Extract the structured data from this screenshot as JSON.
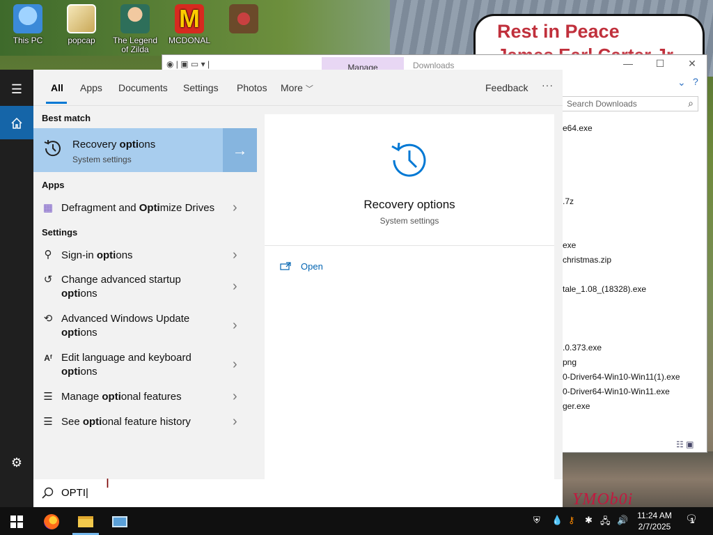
{
  "desktop": {
    "icons": [
      {
        "label": "This PC",
        "icon": "computer-icon",
        "color": "#3b8ad8"
      },
      {
        "label": "popcap",
        "icon": "folder-app-icon",
        "color": "#d0b56a"
      },
      {
        "label": "The Legend of Zilda",
        "icon": "game-character-icon",
        "color": "#3a8a6a"
      },
      {
        "label": "MCDONAL",
        "icon": "mcdonalds-icon",
        "color": "#d62a1f"
      },
      {
        "label": "...",
        "icon": "christmas-icon",
        "color": "#8a5a3a"
      }
    ],
    "sign_line1": "Rest in Peace",
    "sign_line2": "James Earl Carter Jr",
    "graffiti": "YMOb0i"
  },
  "explorer": {
    "manage_label": "Manage",
    "title": "Downloads",
    "search_placeholder": "Search Downloads",
    "files": [
      "e64.exe",
      ".7z",
      "exe",
      "christmas.zip",
      "tale_1.08_(18328).exe",
      ".0.373.exe",
      "png",
      "0-Driver64-Win10-Win11(1).exe",
      "0-Driver64-Win10-Win11.exe",
      "ger.exe"
    ]
  },
  "start_menu": {
    "tabs": [
      {
        "label": "All",
        "active": true
      },
      {
        "label": "Apps",
        "active": false
      },
      {
        "label": "Documents",
        "active": false
      },
      {
        "label": "Settings",
        "active": false
      },
      {
        "label": "Photos",
        "active": false
      },
      {
        "label": "More",
        "active": false
      }
    ],
    "feedback_label": "Feedback",
    "more_options": "···",
    "best_match_heading": "Best match",
    "best_match": {
      "title_before": "Recovery ",
      "title_bold": "opti",
      "title_after": "ons",
      "subtitle": "System settings"
    },
    "apps_heading": "Apps",
    "apps": [
      {
        "before": "Defragment and ",
        "bold": "Opti",
        "after": "mize Drives",
        "icon": "defrag-icon"
      }
    ],
    "settings_heading": "Settings",
    "settings": [
      {
        "before": "Sign-in ",
        "bold": "opti",
        "after": "ons",
        "line2": "",
        "icon": "key-icon"
      },
      {
        "before": "Change advanced startup",
        "bold": "",
        "after": "",
        "line2_bold": "opti",
        "line2_after": "ons",
        "icon": "history-icon"
      },
      {
        "before": "Advanced Windows Update",
        "bold": "",
        "after": "",
        "line2_bold": "opti",
        "line2_after": "ons",
        "icon": "sync-icon"
      },
      {
        "before": "Edit language and keyboard",
        "bold": "",
        "after": "",
        "line2_bold": "opti",
        "line2_after": "ons",
        "icon": "language-icon"
      },
      {
        "before": "Manage ",
        "bold": "opti",
        "after": "onal features",
        "line2": "",
        "icon": "list-icon"
      },
      {
        "before": "See ",
        "bold": "opti",
        "after": "onal feature history",
        "line2": "",
        "icon": "list-icon"
      }
    ],
    "preview": {
      "title": "Recovery options",
      "subtitle": "System settings",
      "open_label": "Open"
    },
    "search_value": "OPTI",
    "accent_color": "#0078d4",
    "selection_color": "#a8cdee"
  },
  "taskbar": {
    "time": "11:24 AM",
    "date": "2/7/2025",
    "notification_count": "1"
  }
}
